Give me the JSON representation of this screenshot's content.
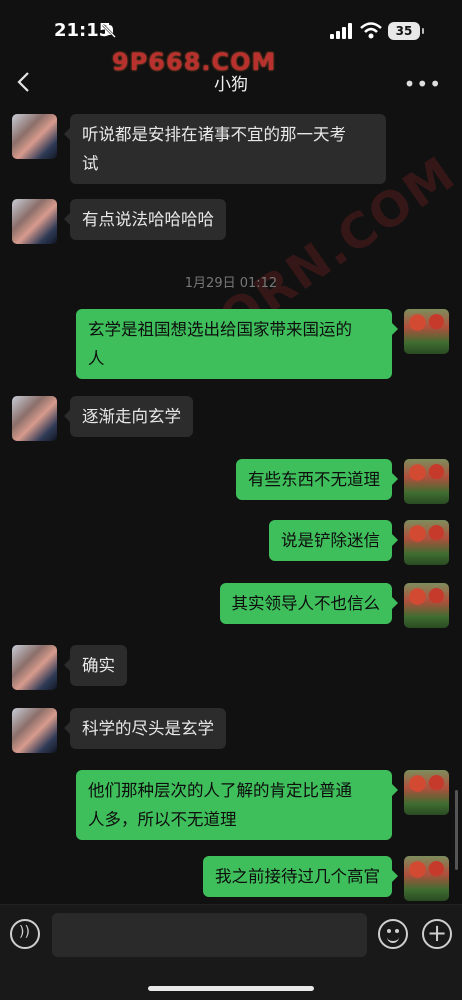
{
  "status_bar": {
    "time": "21:15",
    "battery": "35"
  },
  "header": {
    "title": "小狗",
    "watermark_top": "9P668.COM",
    "watermark_diag": "9PORN.COM"
  },
  "messages": [
    {
      "side": "in",
      "lines": [
        "听说都是安排在诸事不宜的那一天考",
        "试"
      ]
    },
    {
      "side": "in",
      "lines": [
        "有点说法哈哈哈哈"
      ]
    },
    {
      "side": "out",
      "lines": [
        "玄学是祖国想选出给国家带来国运的",
        "人"
      ]
    },
    {
      "side": "in",
      "lines": [
        "逐渐走向玄学"
      ]
    },
    {
      "side": "out",
      "lines": [
        "有些东西不无道理"
      ]
    },
    {
      "side": "out",
      "lines": [
        "说是铲除迷信"
      ]
    },
    {
      "side": "out",
      "lines": [
        "其实领导人不也信么"
      ]
    },
    {
      "side": "in",
      "lines": [
        "确实"
      ]
    },
    {
      "side": "in",
      "lines": [
        "科学的尽头是玄学"
      ]
    },
    {
      "side": "out",
      "lines": [
        "他们那种层次的人了解的肯定比普通",
        "人多，所以不无道理"
      ]
    },
    {
      "side": "out",
      "lines": [
        "我之前接待过几个高官"
      ]
    }
  ],
  "timestamp": "1月29日 01:12"
}
